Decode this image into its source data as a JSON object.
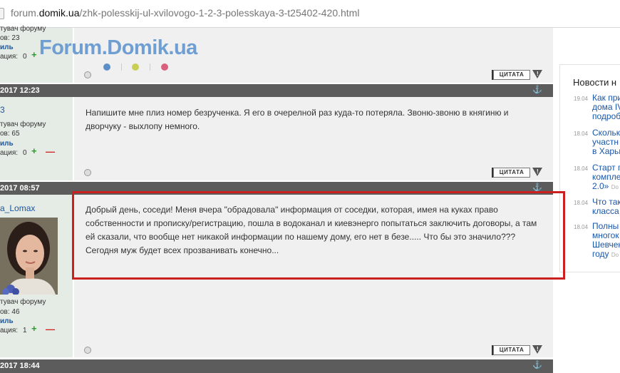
{
  "browser": {
    "url_prefix": "forum.",
    "url_domain": "domik.ua",
    "url_path": "/zhk-polesskij-ul-xvilovogo-1-2-3-polesskaya-3-t25402-420.html"
  },
  "logo": {
    "text": "Forum.Domik.ua",
    "dot_colors": [
      "#5b8fc8",
      "#c9cf55",
      "#d8627c"
    ]
  },
  "post1": {
    "user_line1": "тувач форуму",
    "user_line2": "ов: 23",
    "profile_label": "иль",
    "rating_label": "ация:",
    "rating_value": "0",
    "plus": "+",
    "minus": "—",
    "quote_label": "ЦИТАТА"
  },
  "post2": {
    "date": "2017 12:23",
    "username": "3",
    "user_line1": "тувач форуму",
    "user_line2": "ов: 65",
    "profile_label": "иль",
    "rating_label": "ация:",
    "rating_value": "0",
    "plus": "+",
    "minus": "—",
    "text_line1": "Напишите мне плиз номер безрученка. Я его в очерелной раз куда-то потеряла. Звоню-звоню в княгиню и",
    "text_line2": "дворчуку - выхлопу немного.",
    "quote_label": "ЦИТАТА"
  },
  "post3": {
    "date": "2017 08:57",
    "username": "a_Lomax",
    "user_line1": "тувач форуму",
    "user_line2": "ов: 46",
    "profile_label": "иль",
    "rating_label": "ация:",
    "rating_value": "1",
    "plus": "+",
    "minus": "—",
    "text_line1": "Добрый день, соседи! Меня вчера \"обрадовала\" информация от соседки, которая, имея на куках право",
    "text_line2": "собственности и прописку/регистрацию, пошла в водоканал и киевэнерго попытаться заключить договоры, а там",
    "text_line3": "ей сказали, что вообще нет никакой информации по нашему дому, его нет в безе..... Что бы это значило???",
    "text_line4": "Сегодня муж будет всех прозванивать конечно...",
    "quote_label": "ЦИТАТА"
  },
  "post4": {
    "date": "2017 18:44"
  },
  "news": {
    "title": "Новости н",
    "items": [
      {
        "date": "19.04",
        "lines": [
          "Как при",
          "дома IV",
          "подроб"
        ],
        "source": ""
      },
      {
        "date": "18.04",
        "lines": [
          "Скольк",
          "участн",
          "в Харьк"
        ],
        "source": ""
      },
      {
        "date": "18.04",
        "lines": [
          "Старт п",
          "компле",
          "2.0»"
        ],
        "source": "Do"
      },
      {
        "date": "18.04",
        "lines": [
          "Что так",
          "класса"
        ],
        "source": ""
      },
      {
        "date": "18.04",
        "lines": [
          "Полны",
          "многок",
          "Шевчен",
          "году"
        ],
        "source": "Do"
      }
    ]
  },
  "colors": {
    "highlight_border": "#cc2020",
    "date_bar": "#5c5c5c",
    "user_column": "#e5ebe5",
    "post_background": "#f0f0f0",
    "link": "#1a56a8"
  }
}
